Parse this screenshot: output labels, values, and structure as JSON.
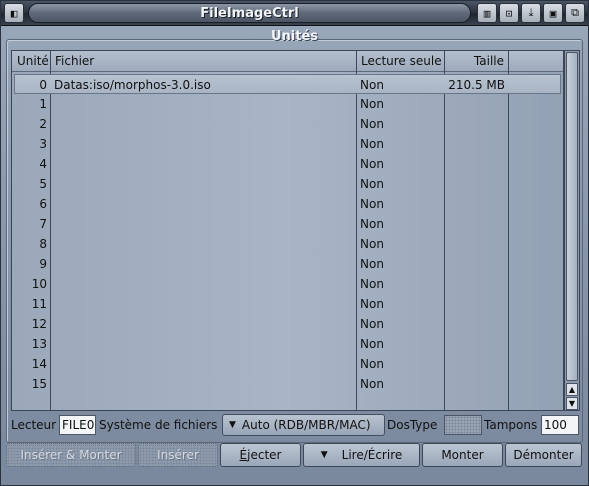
{
  "window": {
    "title": "FileImageCtrl",
    "gadgets": [
      {
        "name": "iconify-gadget",
        "glyph": "▥"
      },
      {
        "name": "prefs-gadget",
        "glyph": "⊡"
      },
      {
        "name": "snapshot-gadget",
        "glyph": "⤓"
      },
      {
        "name": "zoom-gadget",
        "glyph": "▣"
      },
      {
        "name": "depth-gadget",
        "glyph": "⧉"
      }
    ],
    "close_glyph": "◧"
  },
  "group": {
    "title": "Unités"
  },
  "list": {
    "headers": {
      "unit": "Unité",
      "file": "Fichier",
      "readonly": "Lecture seule",
      "size": "Taille"
    },
    "rows": [
      {
        "unit": "0",
        "file": "Datas:iso/morphos-3.0.iso",
        "readonly": "Non",
        "size": "210.5 MB",
        "selected": true
      },
      {
        "unit": "1",
        "file": "",
        "readonly": "Non",
        "size": ""
      },
      {
        "unit": "2",
        "file": "",
        "readonly": "Non",
        "size": ""
      },
      {
        "unit": "3",
        "file": "",
        "readonly": "Non",
        "size": ""
      },
      {
        "unit": "4",
        "file": "",
        "readonly": "Non",
        "size": ""
      },
      {
        "unit": "5",
        "file": "",
        "readonly": "Non",
        "size": ""
      },
      {
        "unit": "6",
        "file": "",
        "readonly": "Non",
        "size": ""
      },
      {
        "unit": "7",
        "file": "",
        "readonly": "Non",
        "size": ""
      },
      {
        "unit": "8",
        "file": "",
        "readonly": "Non",
        "size": ""
      },
      {
        "unit": "9",
        "file": "",
        "readonly": "Non",
        "size": ""
      },
      {
        "unit": "10",
        "file": "",
        "readonly": "Non",
        "size": ""
      },
      {
        "unit": "11",
        "file": "",
        "readonly": "Non",
        "size": ""
      },
      {
        "unit": "12",
        "file": "",
        "readonly": "Non",
        "size": ""
      },
      {
        "unit": "13",
        "file": "",
        "readonly": "Non",
        "size": ""
      },
      {
        "unit": "14",
        "file": "",
        "readonly": "Non",
        "size": ""
      },
      {
        "unit": "15",
        "file": "",
        "readonly": "Non",
        "size": ""
      }
    ]
  },
  "form": {
    "drive_label": "Lecteur",
    "drive_value": "FILE0",
    "fs_label": "Système de fichiers",
    "fs_value": "Auto (RDB/MBR/MAC)",
    "dostype_label": "DosType",
    "buffers_label": "Tampons",
    "buffers_value": "100"
  },
  "buttons": {
    "insert_mount": "Insérer & Monter",
    "insert": "Insérer",
    "eject_first": "É",
    "eject_rest": "jecter",
    "readwrite": "Lire/Écrire",
    "mount": "Monter",
    "unmount": "Démonter"
  },
  "colors": {
    "titlebar": "#2d3441",
    "window_bg": "#8796ab",
    "list_bg": "#a8b5c6"
  }
}
